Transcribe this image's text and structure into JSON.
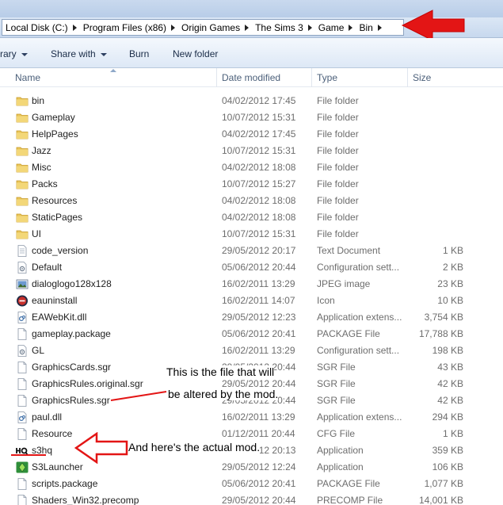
{
  "address_bar": {
    "crumbs": [
      "Local Disk (C:)",
      "Program Files (x86)",
      "Origin Games",
      "The Sims 3",
      "Game",
      "Bin"
    ]
  },
  "toolbar": {
    "library_label": "rary",
    "share_label": "Share with",
    "burn_label": "Burn",
    "new_folder_label": "New folder"
  },
  "columns": {
    "name": "Name",
    "date": "Date modified",
    "type": "Type",
    "size": "Size"
  },
  "files": [
    {
      "name": "bin",
      "date": "04/02/2012 17:45",
      "type": "File folder",
      "size": "",
      "icon": "folder-icon"
    },
    {
      "name": "Gameplay",
      "date": "10/07/2012 15:31",
      "type": "File folder",
      "size": "",
      "icon": "folder-icon"
    },
    {
      "name": "HelpPages",
      "date": "04/02/2012 17:45",
      "type": "File folder",
      "size": "",
      "icon": "folder-icon"
    },
    {
      "name": "Jazz",
      "date": "10/07/2012 15:31",
      "type": "File folder",
      "size": "",
      "icon": "folder-icon"
    },
    {
      "name": "Misc",
      "date": "04/02/2012 18:08",
      "type": "File folder",
      "size": "",
      "icon": "folder-icon"
    },
    {
      "name": "Packs",
      "date": "10/07/2012 15:27",
      "type": "File folder",
      "size": "",
      "icon": "folder-icon"
    },
    {
      "name": "Resources",
      "date": "04/02/2012 18:08",
      "type": "File folder",
      "size": "",
      "icon": "folder-icon"
    },
    {
      "name": "StaticPages",
      "date": "04/02/2012 18:08",
      "type": "File folder",
      "size": "",
      "icon": "folder-icon"
    },
    {
      "name": "UI",
      "date": "10/07/2012 15:31",
      "type": "File folder",
      "size": "",
      "icon": "folder-icon"
    },
    {
      "name": "code_version",
      "date": "29/05/2012 20:17",
      "type": "Text Document",
      "size": "1 KB",
      "icon": "text-file-icon"
    },
    {
      "name": "Default",
      "date": "05/06/2012 20:44",
      "type": "Configuration sett...",
      "size": "2 KB",
      "icon": "config-file-icon"
    },
    {
      "name": "dialoglogo128x128",
      "date": "16/02/2011 13:29",
      "type": "JPEG image",
      "size": "23 KB",
      "icon": "image-file-icon"
    },
    {
      "name": "eauninstall",
      "date": "16/02/2011 14:07",
      "type": "Icon",
      "size": "10 KB",
      "icon": "ea-icon"
    },
    {
      "name": "EAWebKit.dll",
      "date": "29/05/2012 12:23",
      "type": "Application extens...",
      "size": "3,754 KB",
      "icon": "dll-file-icon"
    },
    {
      "name": "gameplay.package",
      "date": "05/06/2012 20:41",
      "type": "PACKAGE File",
      "size": "17,788 KB",
      "icon": "generic-file-icon"
    },
    {
      "name": "GL",
      "date": "16/02/2011 13:29",
      "type": "Configuration sett...",
      "size": "198 KB",
      "icon": "config-file-icon"
    },
    {
      "name": "GraphicsCards.sgr",
      "date": "29/05/2012 20:44",
      "type": "SGR File",
      "size": "43 KB",
      "icon": "generic-file-icon"
    },
    {
      "name": "GraphicsRules.original.sgr",
      "date": "29/05/2012 20:44",
      "type": "SGR File",
      "size": "42 KB",
      "icon": "generic-file-icon"
    },
    {
      "name": "GraphicsRules.sgr",
      "date": "29/05/2012 20:44",
      "type": "SGR File",
      "size": "42 KB",
      "icon": "generic-file-icon"
    },
    {
      "name": "paul.dll",
      "date": "16/02/2011 13:29",
      "type": "Application extens...",
      "size": "294 KB",
      "icon": "dll-file-icon"
    },
    {
      "name": "Resource",
      "date": "01/12/2011 20:44",
      "type": "CFG File",
      "size": "1 KB",
      "icon": "generic-file-icon"
    },
    {
      "name": "s3hq",
      "date": "29/05/2012 20:13",
      "type": "Application",
      "size": "359 KB",
      "icon": "hq-app-icon"
    },
    {
      "name": "S3Launcher",
      "date": "29/05/2012 12:24",
      "type": "Application",
      "size": "106 KB",
      "icon": "sims-launcher-icon"
    },
    {
      "name": "scripts.package",
      "date": "05/06/2012 20:41",
      "type": "PACKAGE File",
      "size": "1,077 KB",
      "icon": "generic-file-icon"
    },
    {
      "name": "Shaders_Win32.precomp",
      "date": "29/05/2012 20:44",
      "type": "PRECOMP File",
      "size": "14,001 KB",
      "icon": "generic-file-icon"
    }
  ],
  "annotations": {
    "graphics_rules_line1": "This  is the file that will",
    "graphics_rules_line2": "be altered by the mod.",
    "mod_note": "And here's the actual mod."
  },
  "colors": {
    "annotation_red": "#e31515",
    "folder_yellow": "#e8c55a"
  }
}
